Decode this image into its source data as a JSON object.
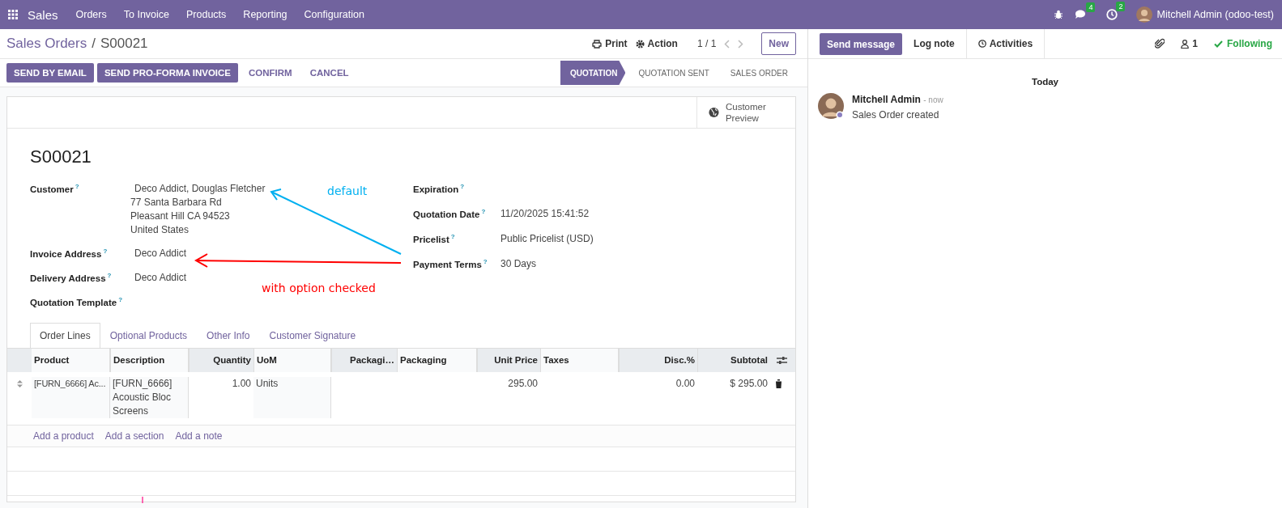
{
  "navbar": {
    "app": "Sales",
    "menu": [
      "Orders",
      "To Invoice",
      "Products",
      "Reporting",
      "Configuration"
    ],
    "messages_count": "4",
    "activities_count": "2",
    "user": "Mitchell Admin (odoo-test)"
  },
  "breadcrumb": {
    "parent": "Sales Orders",
    "separator": "/",
    "current": "S00021"
  },
  "control": {
    "print": "Print",
    "action": "Action",
    "pager": "1 / 1",
    "new": "New"
  },
  "action_buttons": [
    {
      "label": "SEND BY EMAIL",
      "primary": true
    },
    {
      "label": "SEND PRO-FORMA INVOICE",
      "primary": true
    },
    {
      "label": "CONFIRM",
      "primary": false
    },
    {
      "label": "CANCEL",
      "primary": false
    }
  ],
  "stages": [
    {
      "label": "QUOTATION",
      "selected": true
    },
    {
      "label": "QUOTATION SENT",
      "selected": false
    },
    {
      "label": "SALES ORDER",
      "selected": false
    }
  ],
  "sheet": {
    "preview": "Customer Preview",
    "name": "S00021",
    "left_fields": [
      {
        "label": "Customer",
        "help": "?",
        "lines": [
          "Deco Addict, Douglas Fletcher",
          "77 Santa Barbara Rd",
          "Pleasant Hill CA 94523",
          "United States"
        ]
      },
      {
        "label": "Invoice Address",
        "help": "?",
        "lines": [
          "Deco Addict"
        ]
      },
      {
        "label": "Delivery Address",
        "help": "?",
        "lines": [
          "Deco Addict"
        ]
      },
      {
        "label": "Quotation Template",
        "help": "?"
      }
    ],
    "right_fields": [
      {
        "label": "Expiration",
        "help": "?"
      },
      {
        "label": "Quotation Date",
        "help": "?",
        "value": "11/20/2025 15:41:52"
      },
      {
        "label": "Pricelist",
        "help": "?",
        "value": "Public Pricelist (USD)"
      },
      {
        "label": "Payment Terms",
        "help": "?",
        "value": "30 Days"
      }
    ],
    "tabs": [
      {
        "label": "Order Lines",
        "selected": true
      },
      {
        "label": "Optional Products",
        "selected": false
      },
      {
        "label": "Other Info",
        "selected": false
      },
      {
        "label": "Customer Signature",
        "selected": false
      }
    ],
    "table": {
      "columns": [
        "Product",
        "Description",
        "Quantity",
        "UoM",
        "Packagi…",
        "Packaging",
        "Unit Price",
        "Taxes",
        "Disc.%",
        "Subtotal"
      ],
      "rows": [
        {
          "cells": [
            "[FURN_6666] Ac...",
            "[FURN_6666] Acoustic Bloc Screens",
            "1.00",
            "Units",
            "",
            "",
            "295.00",
            "",
            "0.00",
            "$ 295.00"
          ]
        }
      ],
      "add_links": [
        "Add a product",
        "Add a section",
        "Add a note"
      ]
    }
  },
  "annotations": [
    {
      "text": "default",
      "color": "#00b0f0"
    },
    {
      "text": "with option checked",
      "color": "#ff0000"
    }
  ],
  "chatter": {
    "send": "Send message",
    "log": "Log note",
    "activities": "Activities",
    "followers": "1",
    "following": "Following",
    "day": "Today",
    "messages": [
      {
        "author": "Mitchell Admin",
        "time": "- now",
        "body": "Sales Order created"
      }
    ]
  }
}
